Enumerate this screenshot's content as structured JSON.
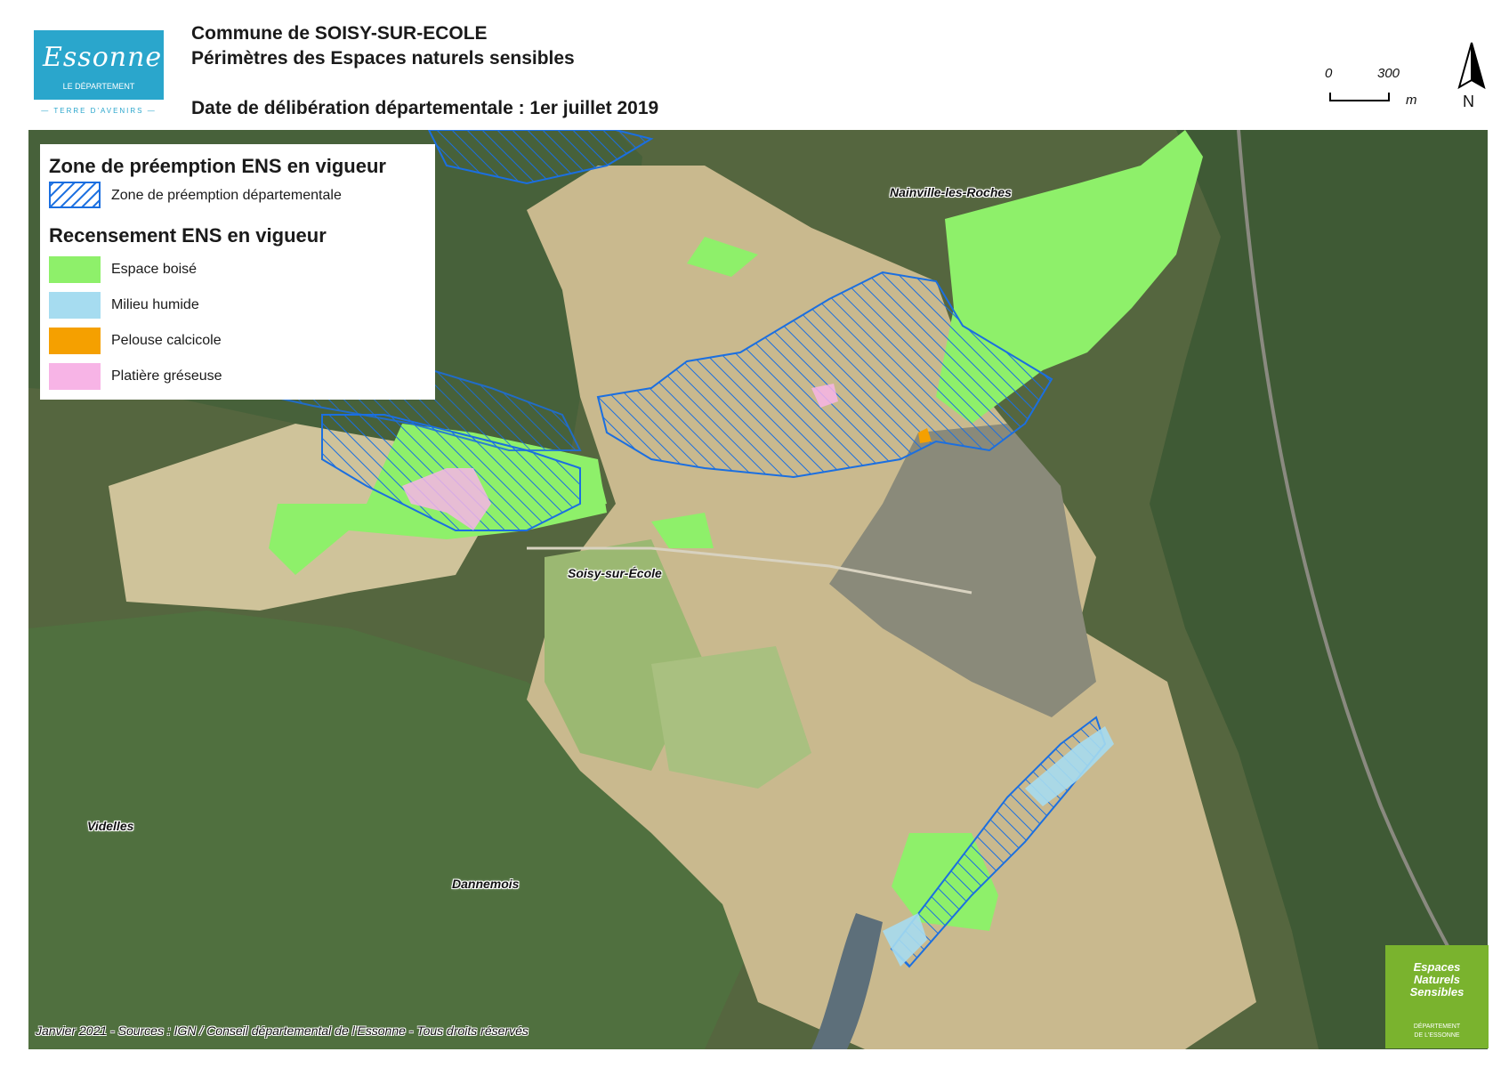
{
  "header": {
    "logo": {
      "script_text": "Essonne",
      "subtitle": "LE DÉPARTEMENT",
      "tagline": "— TERRE D'AVENIRS —"
    },
    "title_line1": "Commune de SOISY-SUR-ECOLE",
    "title_line2": "Périmètres des Espaces naturels sensibles",
    "title_line3": "Date de délibération départementale : 1er juillet 2019"
  },
  "scale": {
    "start": "0",
    "end": "300",
    "unit": "m"
  },
  "north_arrow": {
    "label": "N",
    "icon": "north-arrow-icon"
  },
  "legend": {
    "section1_title": "Zone de préemption ENS en vigueur",
    "section1_items": [
      {
        "label": "Zone de préemption départementale",
        "style": "hatched",
        "color": "#1b6fe0"
      }
    ],
    "section2_title": "Recensement ENS en vigueur",
    "section2_items": [
      {
        "label": "Espace boisé",
        "color": "#8ef06a"
      },
      {
        "label": "Milieu humide",
        "color": "#a6dcf0"
      },
      {
        "label": "Pelouse calcicole",
        "color": "#f5a000"
      },
      {
        "label": "Platière gréseuse",
        "color": "#f7b4e6"
      }
    ]
  },
  "places": {
    "nainville": "Nainville-les-Roches",
    "soisy": "Soisy-sur-École",
    "videlles": "Videlles",
    "dannemois": "Dannemois"
  },
  "credits": "Janvier 2021 - Sources : IGN / Conseil départemental de l'Essonne - Tous droits réservés",
  "ens_logo": {
    "line1": "Espaces",
    "line2": "Naturels",
    "line3": "Sensibles",
    "dept1": "DÉPARTEMENT",
    "dept2": "DE L'ESSONNE"
  },
  "colors": {
    "hatch": "#1b6fe0",
    "forest_dark": "#4a6b3f",
    "fields": "#c9b98e",
    "boise": "#8ef06a",
    "humide": "#a6dcf0",
    "calcicole": "#f5a000",
    "platiere": "#f7b4e6",
    "brand_blue": "#2aa6cc",
    "brand_green": "#7ab32e"
  }
}
